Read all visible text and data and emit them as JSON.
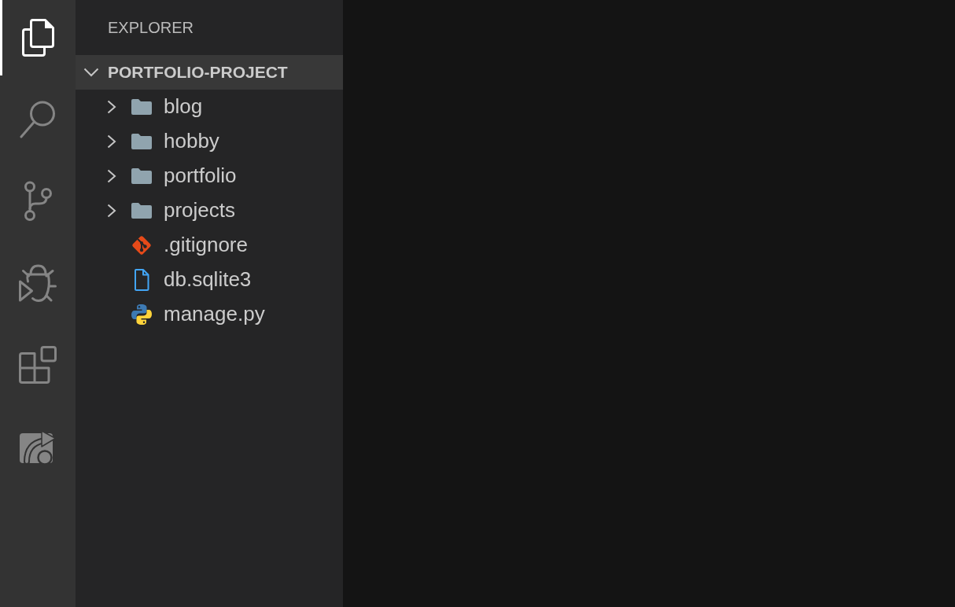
{
  "activity_bar": {
    "items": [
      {
        "kind": "explorer",
        "selected": true
      },
      {
        "kind": "search",
        "selected": false
      },
      {
        "kind": "source-control",
        "selected": false
      },
      {
        "kind": "debug",
        "selected": false
      },
      {
        "kind": "extensions",
        "selected": false
      },
      {
        "kind": "remote",
        "selected": false
      }
    ]
  },
  "sidebar": {
    "title": "EXPLORER",
    "section": {
      "label": "PORTFOLIO-PROJECT",
      "expanded": true
    },
    "items": [
      {
        "label": "blog",
        "kind": "folder",
        "expanded": false
      },
      {
        "label": "hobby",
        "kind": "folder",
        "expanded": false
      },
      {
        "label": "portfolio",
        "kind": "folder",
        "expanded": false
      },
      {
        "label": "projects",
        "kind": "folder",
        "expanded": false
      },
      {
        "label": ".gitignore",
        "kind": "git"
      },
      {
        "label": "db.sqlite3",
        "kind": "file"
      },
      {
        "label": "manage.py",
        "kind": "python"
      }
    ]
  }
}
